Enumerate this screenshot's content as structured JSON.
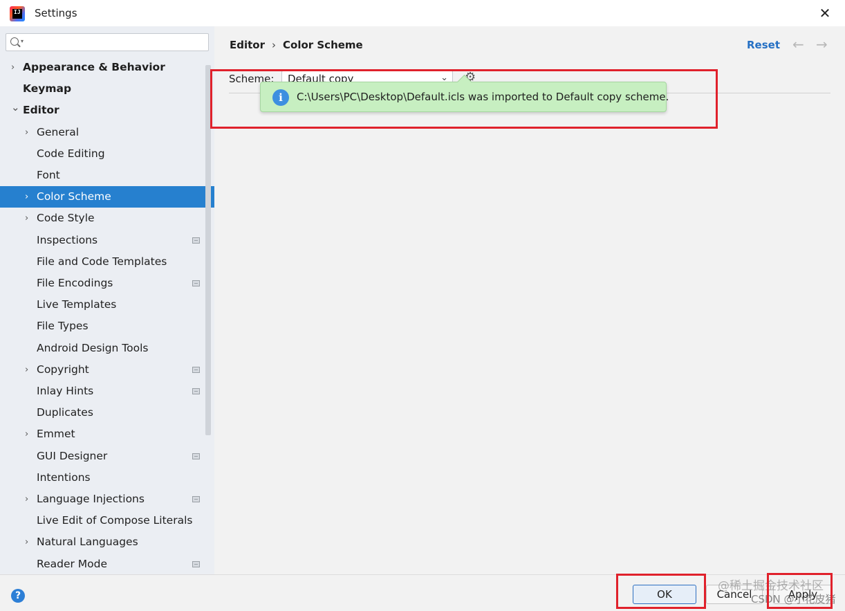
{
  "window": {
    "title": "Settings",
    "close_glyph": "✕"
  },
  "search": {
    "placeholder": ""
  },
  "sidebar": {
    "items": [
      {
        "label": "Appearance & Behavior",
        "level": 0,
        "arrow": "right",
        "bold": true
      },
      {
        "label": "Keymap",
        "level": 0,
        "arrow": "none",
        "bold": true
      },
      {
        "label": "Editor",
        "level": 0,
        "arrow": "down",
        "bold": true
      },
      {
        "label": "General",
        "level": 1,
        "arrow": "right"
      },
      {
        "label": "Code Editing",
        "level": 1,
        "arrow": "none"
      },
      {
        "label": "Font",
        "level": 1,
        "arrow": "none"
      },
      {
        "label": "Color Scheme",
        "level": 1,
        "arrow": "right",
        "selected": true
      },
      {
        "label": "Code Style",
        "level": 1,
        "arrow": "right"
      },
      {
        "label": "Inspections",
        "level": 1,
        "arrow": "none",
        "project_icon": true
      },
      {
        "label": "File and Code Templates",
        "level": 1,
        "arrow": "none"
      },
      {
        "label": "File Encodings",
        "level": 1,
        "arrow": "none",
        "project_icon": true
      },
      {
        "label": "Live Templates",
        "level": 1,
        "arrow": "none"
      },
      {
        "label": "File Types",
        "level": 1,
        "arrow": "none"
      },
      {
        "label": "Android Design Tools",
        "level": 1,
        "arrow": "none"
      },
      {
        "label": "Copyright",
        "level": 1,
        "arrow": "right",
        "project_icon": true
      },
      {
        "label": "Inlay Hints",
        "level": 1,
        "arrow": "none",
        "project_icon": true
      },
      {
        "label": "Duplicates",
        "level": 1,
        "arrow": "none"
      },
      {
        "label": "Emmet",
        "level": 1,
        "arrow": "right"
      },
      {
        "label": "GUI Designer",
        "level": 1,
        "arrow": "none",
        "project_icon": true
      },
      {
        "label": "Intentions",
        "level": 1,
        "arrow": "none"
      },
      {
        "label": "Language Injections",
        "level": 1,
        "arrow": "right",
        "project_icon": true
      },
      {
        "label": "Live Edit of Compose Literals",
        "level": 1,
        "arrow": "none"
      },
      {
        "label": "Natural Languages",
        "level": 1,
        "arrow": "right"
      },
      {
        "label": "Reader Mode",
        "level": 1,
        "arrow": "none",
        "project_icon": true
      }
    ]
  },
  "main": {
    "breadcrumb": {
      "parent": "Editor",
      "separator": "›",
      "current": "Color Scheme"
    },
    "reset_label": "Reset",
    "back_glyph": "←",
    "forward_glyph": "→",
    "scheme_label": "Scheme:",
    "scheme_value": "Default copy",
    "notification": {
      "icon": "info-icon",
      "text": "C:\\Users\\PC\\Desktop\\Default.icls was imported to Default copy scheme."
    }
  },
  "footer": {
    "help_glyph": "?",
    "ok_label": "OK",
    "cancel_label": "Cancel",
    "apply_label": "Apply",
    "watermark_line1": "@稀土掘金技术社区",
    "watermark_line2": "CSDN @小花皮猪"
  },
  "colors": {
    "selection": "#2680cf",
    "link": "#2570c4",
    "notification_bg": "#c7efc1",
    "annotation_red": "#e0212b",
    "sidebar_bg": "#ebeef3",
    "panel_bg": "#f2f2f2"
  }
}
